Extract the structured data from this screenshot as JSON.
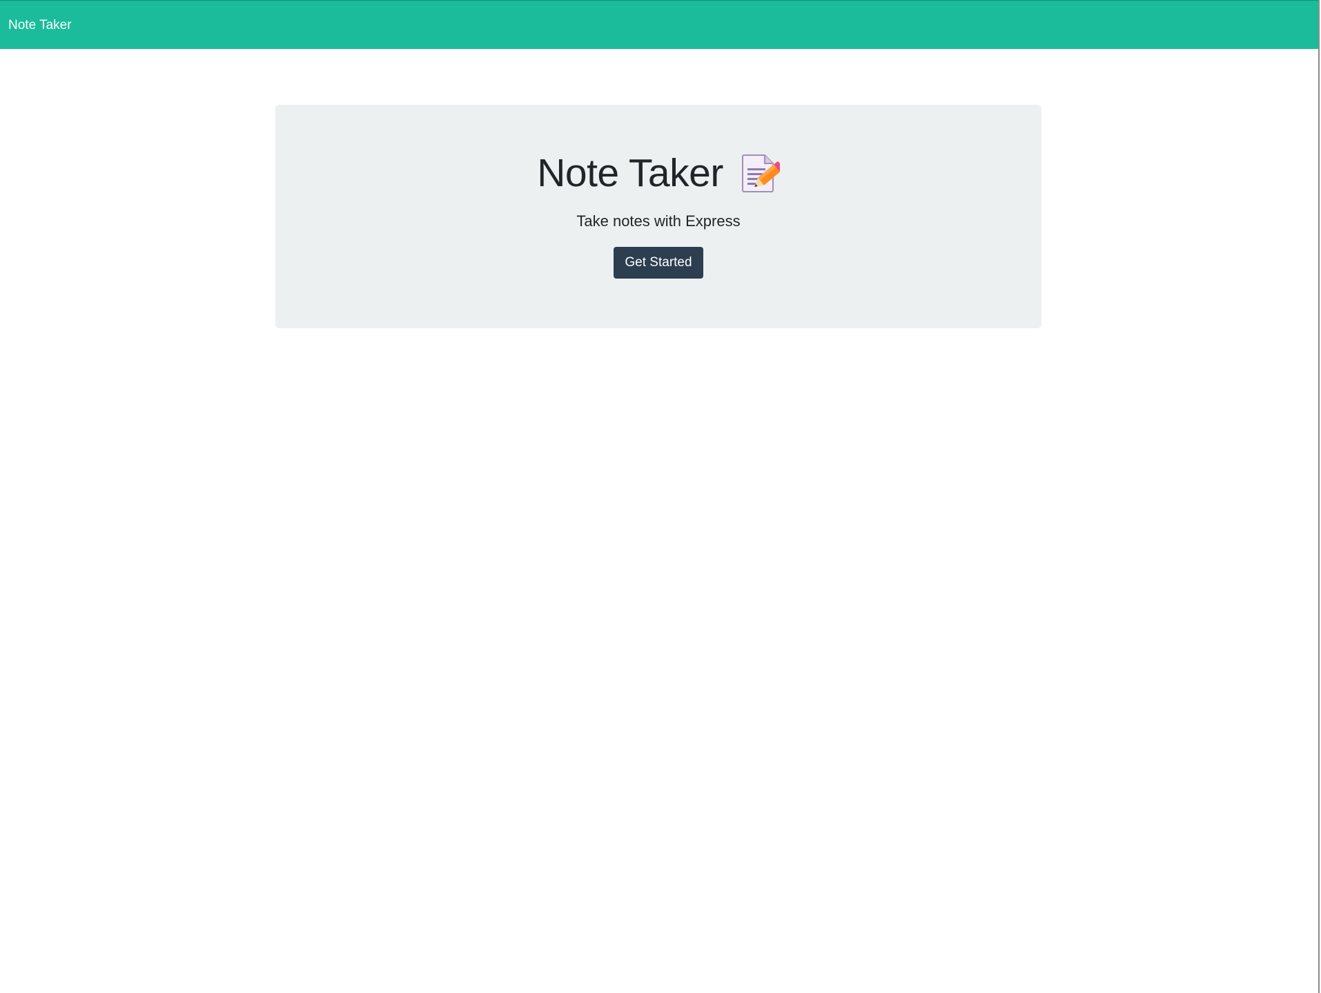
{
  "navbar": {
    "brand": "Note Taker",
    "background_color": "#1abc9c"
  },
  "hero": {
    "title": "Note Taker",
    "icon": "memo-icon",
    "subtitle": "Take notes with Express",
    "cta_label": "Get Started",
    "background_color": "#ecf0f1",
    "button_color": "#2c3e50"
  }
}
